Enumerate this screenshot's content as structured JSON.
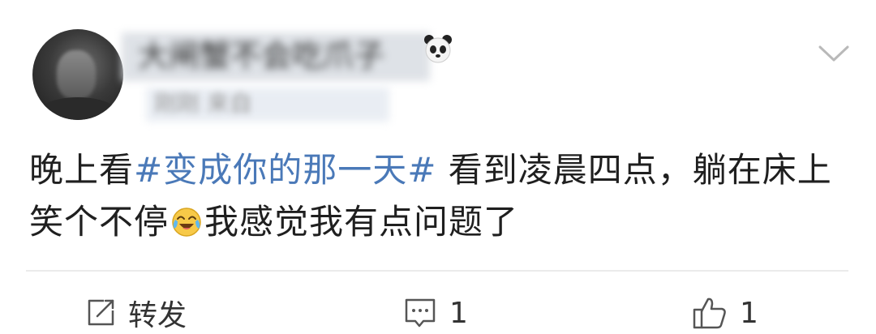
{
  "post": {
    "username": "大闸蟹不会吃爪子",
    "meta": "刚刚 来自",
    "text_before": "晚上看",
    "hashtag": "#变成你的那一天#",
    "text_middle": " 看到凌晨四点，躺在床上笑个不停",
    "emoji_name": "laugh-cry-emoji-icon",
    "text_after": "我感觉我有点问题了"
  },
  "actions": {
    "repost_label": "转发",
    "comment_count": "1",
    "like_count": "1"
  },
  "colors": {
    "hashtag": "#4a79b8",
    "text": "#1f1f1f",
    "muted": "#9a9a9a",
    "divider": "#ebebeb"
  }
}
